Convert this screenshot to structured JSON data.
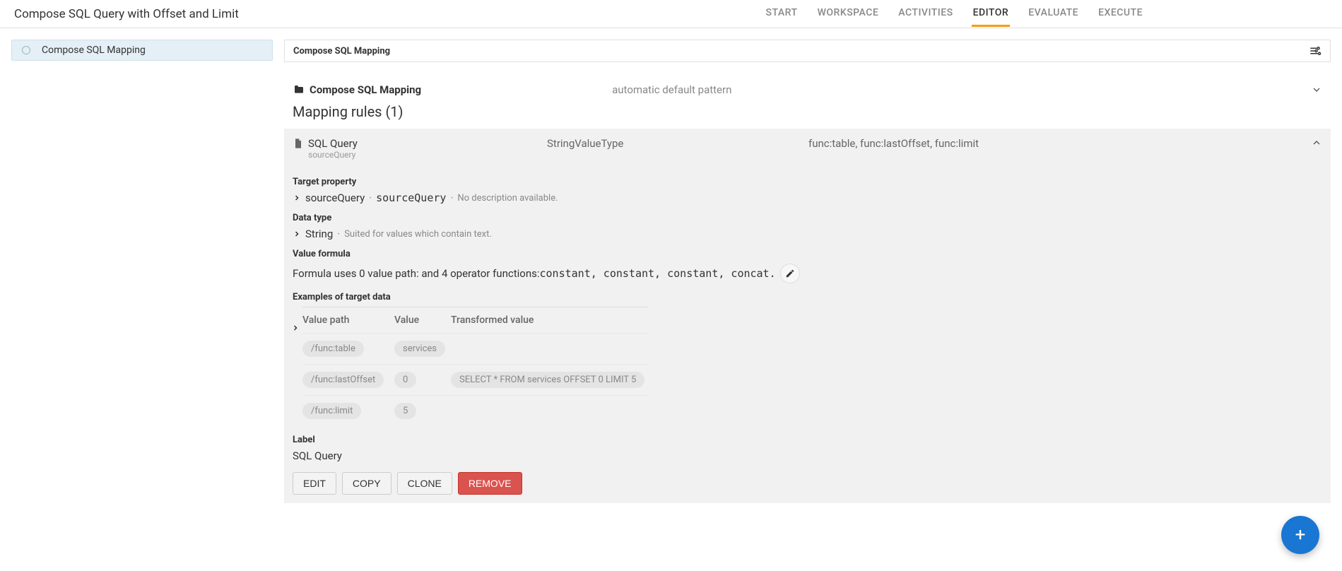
{
  "page_title": "Compose SQL Query with Offset and Limit",
  "tabs": [
    "START",
    "WORKSPACE",
    "ACTIVITIES",
    "EDITOR",
    "EVALUATE",
    "EXECUTE"
  ],
  "active_tab": "EDITOR",
  "sidebar": {
    "items": [
      {
        "label": "Compose SQL Mapping"
      }
    ]
  },
  "panel": {
    "title": "Compose SQL Mapping",
    "folder_label": "Compose SQL Mapping",
    "folder_meta": "automatic default pattern",
    "rules_title": "Mapping rules (1)"
  },
  "rule": {
    "name": "SQL Query",
    "subtitle": "sourceQuery",
    "col2": "StringValueType",
    "col3": "func:table, func:lastOffset, func:limit"
  },
  "target": {
    "label": "Target property",
    "path1": "sourceQuery",
    "path2": "sourceQuery",
    "desc": "No description available."
  },
  "datatype": {
    "label": "Data type",
    "name": "String",
    "desc": "Suited for values which contain text."
  },
  "formula": {
    "label": "Value formula",
    "pre": "Formula uses 0 value path:  and 4 operator functions: ",
    "funcs": "constant, constant, constant, concat.",
    "dot": ""
  },
  "examples": {
    "label": "Examples of target data",
    "head": {
      "c1": "Value path",
      "c2": "Value",
      "c3": "Transformed value"
    },
    "rows": [
      {
        "path": "/func:table",
        "value": "services",
        "transformed": ""
      },
      {
        "path": "/func:lastOffset",
        "value": "0",
        "transformed": "SELECT * FROM services OFFSET 0 LIMIT 5"
      },
      {
        "path": "/func:limit",
        "value": "5",
        "transformed": ""
      }
    ]
  },
  "label_section": {
    "label": "Label",
    "value": "SQL Query"
  },
  "buttons": {
    "edit": "EDIT",
    "copy": "COPY",
    "clone": "CLONE",
    "remove": "REMOVE"
  }
}
